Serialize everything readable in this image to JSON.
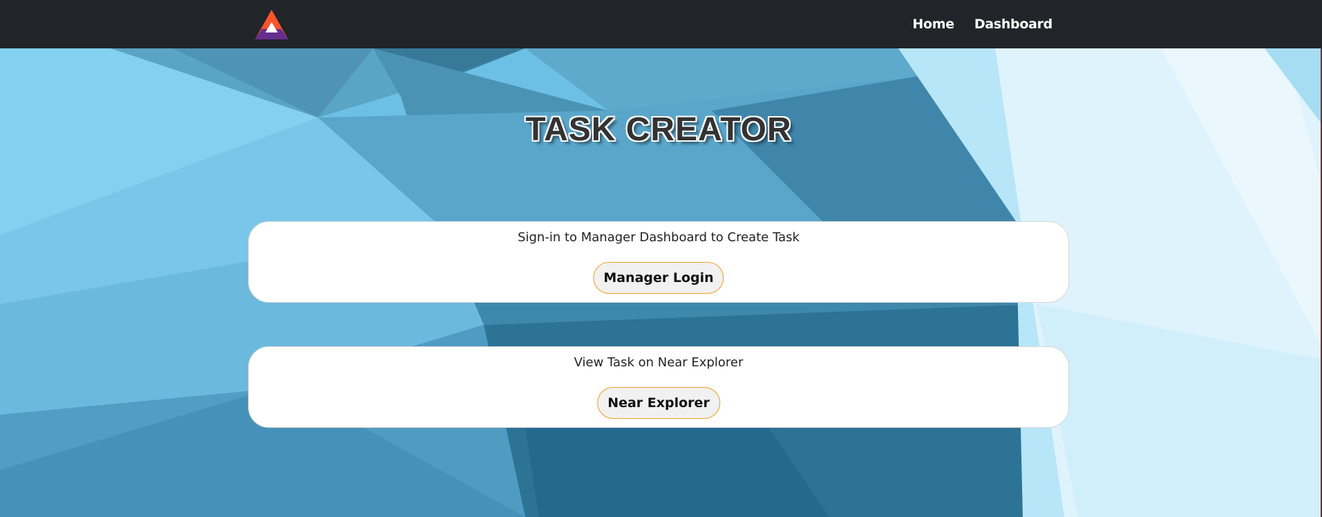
{
  "colors": {
    "navbar_bg": "#212429",
    "button_border": "#f0a024",
    "button_bg": "#f1f1f1",
    "card_bg": "#ffffff",
    "title_color": "#333333",
    "logo_orange": "#fb542b",
    "logo_purple": "#662d91"
  },
  "navbar": {
    "logo_icon": "triangle-logo-icon",
    "links": [
      "Home",
      "Dashboard"
    ]
  },
  "main": {
    "title": "TASK CREATOR",
    "cards": [
      {
        "text": "Sign-in to Manager Dashboard to Create Task",
        "button_label": "Manager Login"
      },
      {
        "text": "View Task on Near Explorer",
        "button_label": "Near Explorer"
      }
    ]
  }
}
